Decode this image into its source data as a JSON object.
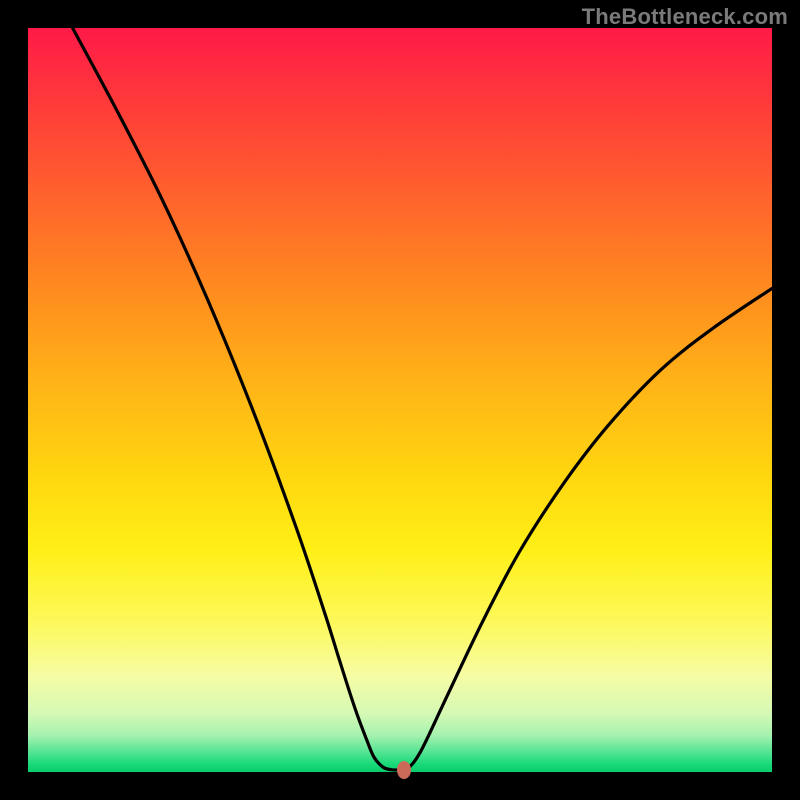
{
  "watermark": "TheBottleneck.com",
  "chart_data": {
    "type": "line",
    "title": "",
    "xlabel": "",
    "ylabel": "",
    "xlim": [
      0,
      1
    ],
    "ylim": [
      0,
      1
    ],
    "series": [
      {
        "name": "curve",
        "x": [
          0.06,
          0.12,
          0.18,
          0.24,
          0.3,
          0.36,
          0.4,
          0.42,
          0.44,
          0.455,
          0.465,
          0.478,
          0.49,
          0.5,
          0.51,
          0.528,
          0.56,
          0.61,
          0.66,
          0.72,
          0.78,
          0.85,
          0.92,
          1.0
        ],
        "y": [
          1.0,
          0.888,
          0.77,
          0.638,
          0.492,
          0.33,
          0.21,
          0.146,
          0.084,
          0.044,
          0.02,
          0.006,
          0.003,
          0.003,
          0.004,
          0.028,
          0.095,
          0.2,
          0.295,
          0.388,
          0.466,
          0.54,
          0.596,
          0.65
        ]
      }
    ],
    "marker": {
      "x": 0.505,
      "y": 0.003,
      "color": "#cc6a5a"
    },
    "gradient_stops": [
      {
        "pos": 0.0,
        "color": "#ff1a48"
      },
      {
        "pos": 0.5,
        "color": "#ffc410"
      },
      {
        "pos": 0.8,
        "color": "#fdf95c"
      },
      {
        "pos": 1.0,
        "color": "#0acc6b"
      }
    ]
  }
}
